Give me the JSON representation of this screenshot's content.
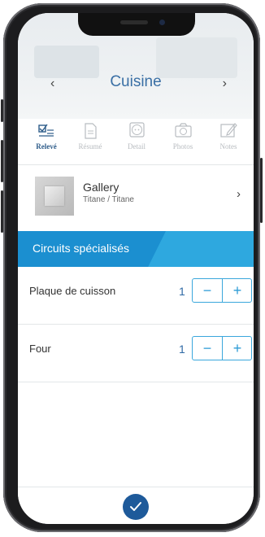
{
  "header": {
    "title": "Cuisine",
    "prev_icon": "chevron-left-icon",
    "next_icon": "chevron-right-icon"
  },
  "tabs": [
    {
      "label": "Relevé",
      "icon": "checklist-icon",
      "active": true
    },
    {
      "label": "Résumé",
      "icon": "document-icon",
      "active": false
    },
    {
      "label": "Detail",
      "icon": "outlet-icon",
      "active": false
    },
    {
      "label": "Photos",
      "icon": "camera-icon",
      "active": false
    },
    {
      "label": "Notes",
      "icon": "note-pen-icon",
      "active": false
    }
  ],
  "product": {
    "name": "Gallery",
    "finish": "Titane / Titane"
  },
  "section": {
    "title": "Circuits spécialisés"
  },
  "circuits": [
    {
      "label": "Plaque de cuisson",
      "quantity": "1"
    },
    {
      "label": "Four",
      "quantity": "1"
    }
  ],
  "stepper": {
    "minus": "−",
    "plus": "+"
  },
  "colors": {
    "accent": "#2ea8df",
    "banner_dark": "#1b8fd0",
    "primary": "#1e5a9a"
  }
}
